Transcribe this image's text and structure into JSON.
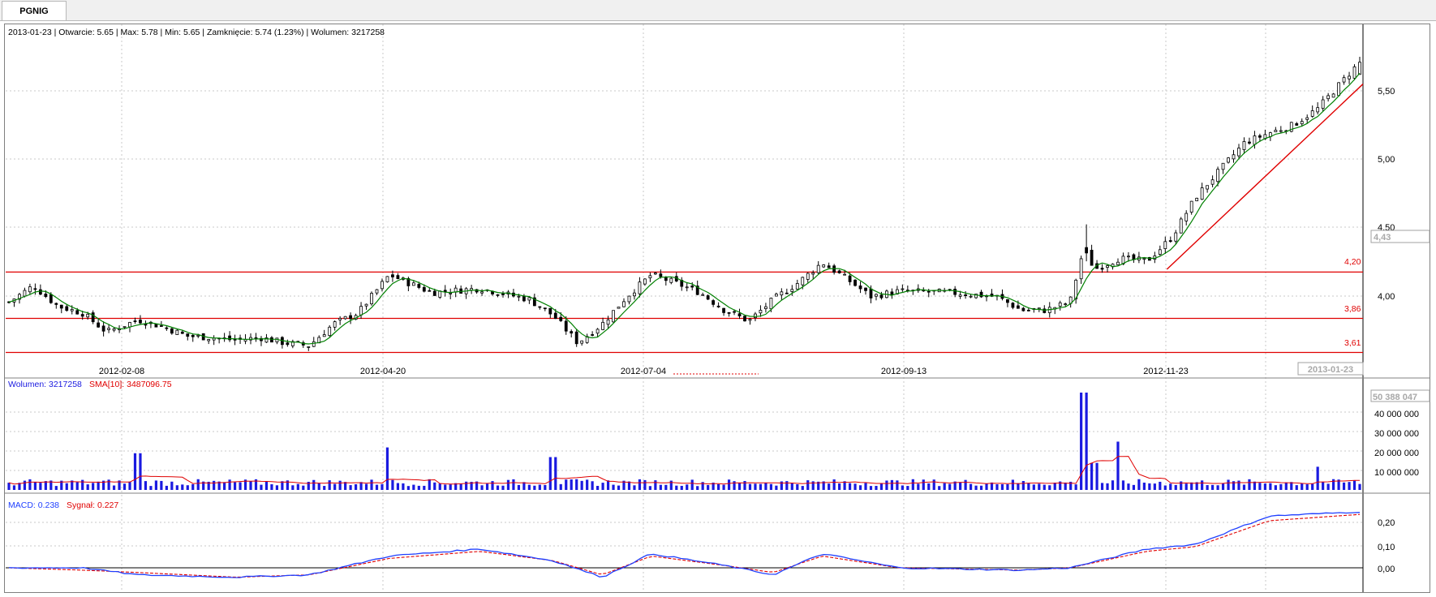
{
  "tab": {
    "label": "PGNIG"
  },
  "price_info": "2013-01-23 | Otwarcie: 5.65 | Max: 5.78 | Min: 5.65 | Zamknięcie: 5.74 (1.23%)  | Wolumen: 3217258",
  "price_axis": {
    "ticks": [
      "5,50",
      "5,00",
      "4,50",
      "4,00"
    ],
    "current_label": "4,43"
  },
  "date_labels": [
    "2012-02-08",
    "2012-04-20",
    "2012-07-04",
    "2012-09-13",
    "2012-11-23"
  ],
  "date_current": "2013-01-23",
  "levels": [
    {
      "label": "4,20",
      "value": 4.2
    },
    {
      "label": "3,86",
      "value": 3.86
    },
    {
      "label": "3,61",
      "value": 3.61
    }
  ],
  "volume_legend": {
    "volume": "Wolumen: 3217258",
    "sma": "SMA[10]: 3487096.75"
  },
  "volume_axis": {
    "ticks": [
      "40 000 000",
      "30 000 000",
      "20 000 000",
      "10 000 000"
    ],
    "max_label": "50 388 047"
  },
  "macd_legend": {
    "macd": "MACD: 0.238",
    "signal": "Sygnał: 0.227"
  },
  "macd_axis": {
    "ticks": [
      "0,20",
      "0,10",
      "0,00"
    ]
  },
  "colors": {
    "up_candle": "#ffffff",
    "down_candle": "#000000",
    "sma_line": "#008000",
    "level_line": "#e00000",
    "volume_bar": "#1a1ae0",
    "volume_sma": "#e00000",
    "macd": "#1f3fff",
    "signal": "#e00000",
    "grid": "#c8c8c8"
  },
  "chart_data": [
    {
      "type": "candlestick",
      "title": "PGNIG",
      "last": {
        "date": "2013-01-23",
        "open": 5.65,
        "high": 5.78,
        "low": 5.65,
        "close": 5.74
      },
      "y_range": [
        3.61,
        5.9
      ],
      "x_range": [
        "2012-01-02",
        "2013-01-23"
      ],
      "close_path": [
        [
          "2012-01-02",
          3.98
        ],
        [
          "2012-01-09",
          4.1
        ],
        [
          "2012-01-16",
          3.95
        ],
        [
          "2012-01-23",
          3.9
        ],
        [
          "2012-01-30",
          3.76
        ],
        [
          "2012-02-08",
          3.85
        ],
        [
          "2012-02-15",
          3.8
        ],
        [
          "2012-02-22",
          3.73
        ],
        [
          "2012-02-29",
          3.72
        ],
        [
          "2012-03-07",
          3.7
        ],
        [
          "2012-03-14",
          3.72
        ],
        [
          "2012-03-21",
          3.68
        ],
        [
          "2012-03-28",
          3.66
        ],
        [
          "2012-04-04",
          3.82
        ],
        [
          "2012-04-11",
          3.9
        ],
        [
          "2012-04-20",
          4.18
        ],
        [
          "2012-05-02",
          4.05
        ],
        [
          "2012-05-16",
          4.08
        ],
        [
          "2012-05-30",
          4.0
        ],
        [
          "2012-06-06",
          3.88
        ],
        [
          "2012-06-13",
          3.68
        ],
        [
          "2012-06-20",
          3.82
        ],
        [
          "2012-06-27",
          4.02
        ],
        [
          "2012-07-04",
          4.18
        ],
        [
          "2012-07-11",
          4.12
        ],
        [
          "2012-07-18",
          4.05
        ],
        [
          "2012-07-25",
          3.92
        ],
        [
          "2012-08-01",
          3.84
        ],
        [
          "2012-08-08",
          4.0
        ],
        [
          "2012-08-15",
          4.12
        ],
        [
          "2012-08-22",
          4.27
        ],
        [
          "2012-08-29",
          4.15
        ],
        [
          "2012-09-05",
          4.02
        ],
        [
          "2012-09-13",
          4.06
        ],
        [
          "2012-09-27",
          4.05
        ],
        [
          "2012-10-11",
          4.02
        ],
        [
          "2012-10-18",
          3.92
        ],
        [
          "2012-10-25",
          3.92
        ],
        [
          "2012-11-01",
          3.98
        ],
        [
          "2012-11-05",
          4.38
        ],
        [
          "2012-11-08",
          4.22
        ],
        [
          "2012-11-15",
          4.3
        ],
        [
          "2012-11-23",
          4.28
        ],
        [
          "2012-11-30",
          4.45
        ],
        [
          "2012-12-07",
          4.75
        ],
        [
          "2012-12-14",
          4.95
        ],
        [
          "2012-12-21",
          5.15
        ],
        [
          "2012-12-28",
          5.22
        ],
        [
          "2013-01-04",
          5.28
        ],
        [
          "2013-01-11",
          5.4
        ],
        [
          "2013-01-18",
          5.6
        ],
        [
          "2013-01-23",
          5.74
        ]
      ]
    },
    {
      "type": "bar",
      "title": "Wolumen",
      "series": [
        {
          "name": "Wolumen"
        },
        {
          "name": "SMA[10]"
        }
      ],
      "ylim": [
        0,
        50388047
      ],
      "spikes": [
        [
          "2012-02-08",
          19000000
        ],
        [
          "2012-04-20",
          22000000
        ],
        [
          "2012-06-06",
          17000000
        ],
        [
          "2012-11-05",
          50388047
        ],
        [
          "2012-11-08",
          14000000
        ],
        [
          "2012-11-15",
          25000000
        ],
        [
          "2013-01-11",
          12000000
        ]
      ],
      "typical_volume": 4000000
    },
    {
      "type": "line",
      "title": "MACD",
      "series": [
        {
          "name": "MACD"
        },
        {
          "name": "Sygnał"
        }
      ],
      "ylim": [
        -0.08,
        0.28
      ],
      "macd_path": [
        [
          "2012-01-02",
          0.0
        ],
        [
          "2012-01-23",
          0.0
        ],
        [
          "2012-02-08",
          -0.03
        ],
        [
          "2012-03-07",
          -0.04
        ],
        [
          "2012-03-28",
          -0.03
        ],
        [
          "2012-04-20",
          0.05
        ],
        [
          "2012-05-16",
          0.08
        ],
        [
          "2012-06-06",
          0.03
        ],
        [
          "2012-06-20",
          -0.04
        ],
        [
          "2012-07-04",
          0.06
        ],
        [
          "2012-07-25",
          0.01
        ],
        [
          "2012-08-08",
          -0.03
        ],
        [
          "2012-08-22",
          0.06
        ],
        [
          "2012-09-13",
          0.0
        ],
        [
          "2012-10-18",
          -0.01
        ],
        [
          "2012-11-01",
          0.0
        ],
        [
          "2012-11-23",
          0.08
        ],
        [
          "2012-12-07",
          0.1
        ],
        [
          "2012-12-28",
          0.22
        ],
        [
          "2013-01-23",
          0.238
        ]
      ],
      "signal_path": [
        [
          "2012-01-02",
          0.0
        ],
        [
          "2012-01-23",
          -0.01
        ],
        [
          "2012-02-08",
          -0.02
        ],
        [
          "2012-03-07",
          -0.04
        ],
        [
          "2012-03-28",
          -0.03
        ],
        [
          "2012-04-20",
          0.04
        ],
        [
          "2012-05-16",
          0.07
        ],
        [
          "2012-06-06",
          0.03
        ],
        [
          "2012-06-20",
          -0.03
        ],
        [
          "2012-07-04",
          0.05
        ],
        [
          "2012-07-25",
          0.01
        ],
        [
          "2012-08-08",
          -0.02
        ],
        [
          "2012-08-22",
          0.05
        ],
        [
          "2012-09-13",
          0.0
        ],
        [
          "2012-10-18",
          -0.01
        ],
        [
          "2012-11-01",
          0.0
        ],
        [
          "2012-11-23",
          0.07
        ],
        [
          "2012-12-07",
          0.09
        ],
        [
          "2012-12-28",
          0.2
        ],
        [
          "2013-01-23",
          0.227
        ]
      ]
    }
  ]
}
